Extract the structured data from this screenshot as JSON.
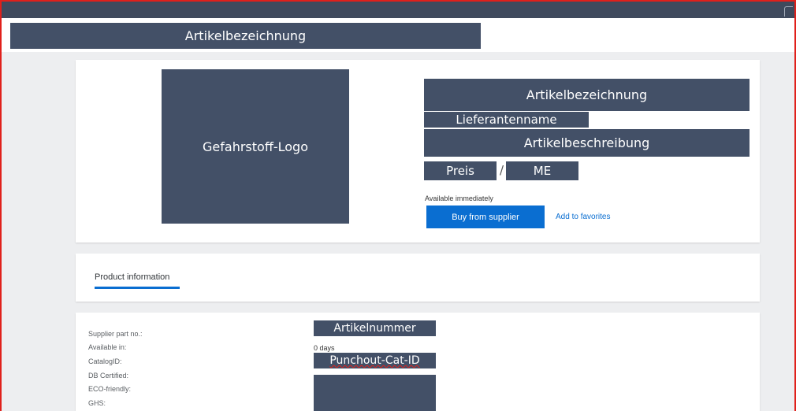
{
  "header": {
    "title_placeholder": "Artikelbezeichnung"
  },
  "product": {
    "logo_placeholder": "Gefahrstoff-Logo",
    "name_placeholder": "Artikelbezeichnung",
    "supplier_placeholder": "Lieferantenname",
    "description_placeholder": "Artikelbeschreibung",
    "price_placeholder": "Preis",
    "price_separator": "/",
    "unit_placeholder": "ME",
    "availability_text": "Available immediately",
    "buy_button_label": "Buy from supplier",
    "favorites_link_label": "Add to favorites"
  },
  "tabs": [
    {
      "label": "Product information"
    }
  ],
  "details": {
    "labels": [
      "Supplier part no.:",
      "Available in:",
      "CatalogID:",
      "DB Certified:",
      "ECO-friendly:",
      "GHS:"
    ],
    "part_number_placeholder": "Artikelnummer",
    "available_in_value": "0 days",
    "catalog_id_placeholder": "Punchout-Cat-ID"
  },
  "colors": {
    "placeholder_fill": "#435067",
    "accent_blue": "#0a6ed1",
    "frame_border": "#e0201b",
    "top_bar": "#3f4a5d",
    "page_background": "#edeef0"
  }
}
